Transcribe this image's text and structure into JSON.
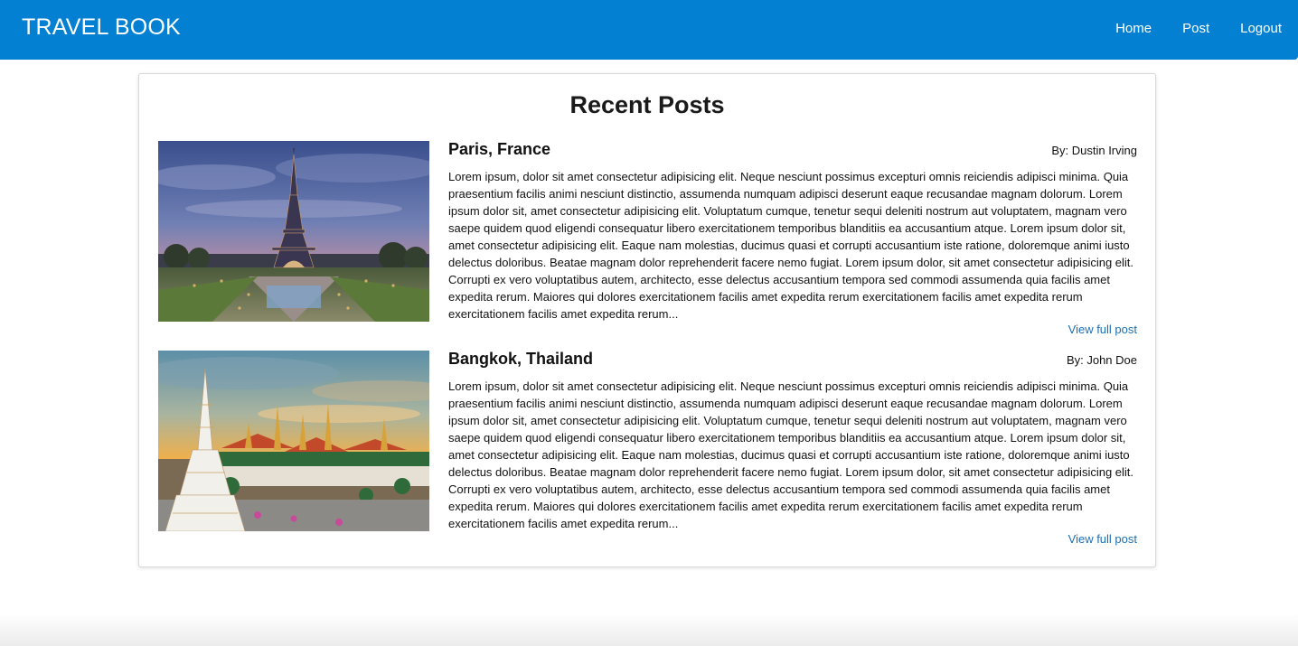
{
  "navbar": {
    "brand": "TRAVEL BOOK",
    "links": [
      "Home",
      "Post",
      "Logout"
    ],
    "background": "#0480d3"
  },
  "main": {
    "title": "Recent Posts",
    "posts": [
      {
        "title": "Paris, France",
        "author": "By: Dustin Irving",
        "excerpt": "Lorem ipsum, dolor sit amet consectetur adipisicing elit. Neque nesciunt possimus excepturi omnis reiciendis adipisci minima. Quia praesentium facilis animi nesciunt distinctio, assumenda numquam adipisci deserunt eaque recusandae magnam dolorum. Lorem ipsum dolor sit, amet consectetur adipisicing elit. Voluptatum cumque, tenetur sequi deleniti nostrum aut voluptatem, magnam vero saepe quidem quod eligendi consequatur libero exercitationem temporibus blanditiis ea accusantium atque. Lorem ipsum dolor sit, amet consectetur adipisicing elit. Eaque nam molestias, ducimus quasi et corrupti accusantium iste ratione, doloremque animi iusto delectus doloribus. Beatae magnam dolor reprehenderit facere nemo fugiat. Lorem ipsum dolor, sit amet consectetur adipisicing elit. Corrupti ex vero voluptatibus autem, architecto, esse delectus accusantium tempora sed commodi assumenda quia facilis amet expedita rerum. Maiores qui dolores exercitationem facilis amet expedita rerum exercitationem facilis amet expedita rerum exercitationem facilis amet expedita rerum...",
        "link": "View full post",
        "image": "eiffel-tower-photo"
      },
      {
        "title": "Bangkok, Thailand",
        "author": "By: John Doe",
        "excerpt": "Lorem ipsum, dolor sit amet consectetur adipisicing elit. Neque nesciunt possimus excepturi omnis reiciendis adipisci minima. Quia praesentium facilis animi nesciunt distinctio, assumenda numquam adipisci deserunt eaque recusandae magnam dolorum. Lorem ipsum dolor sit, amet consectetur adipisicing elit. Voluptatum cumque, tenetur sequi deleniti nostrum aut voluptatem, magnam vero saepe quidem quod eligendi consequatur libero exercitationem temporibus blanditiis ea accusantium atque. Lorem ipsum dolor sit, amet consectetur adipisicing elit. Eaque nam molestias, ducimus quasi et corrupti accusantium iste ratione, doloremque animi iusto delectus doloribus. Beatae magnam dolor reprehenderit facere nemo fugiat. Lorem ipsum dolor, sit amet consectetur adipisicing elit. Corrupti ex vero voluptatibus autem, architecto, esse delectus accusantium tempora sed commodi assumenda quia facilis amet expedita rerum. Maiores qui dolores exercitationem facilis amet expedita rerum exercitationem facilis amet expedita rerum exercitationem facilis amet expedita rerum...",
        "link": "View full post",
        "image": "grand-palace-photo"
      }
    ]
  }
}
